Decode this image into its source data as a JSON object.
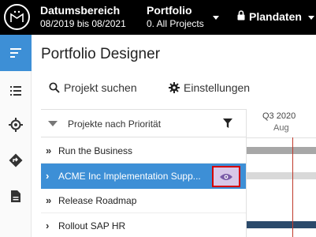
{
  "topbar": {
    "date_label": "Datumsbereich",
    "date_value": "08/2019 bis 08/2021",
    "portfolio_label": "Portfolio",
    "portfolio_value": "0. All Projects",
    "plan_label": "Plandaten"
  },
  "title": "Portfolio Designer",
  "toolbar": {
    "search_label": "Projekt suchen",
    "settings_label": "Einstellungen"
  },
  "tree": {
    "header_label": "Projekte nach Priorität",
    "rows": [
      {
        "label": "Run the Business",
        "chevron": "»"
      },
      {
        "label": "ACME Inc Implementation Supp...",
        "chevron": "›"
      },
      {
        "label": "Release Roadmap",
        "chevron": "»"
      },
      {
        "label": "Rollout SAP HR",
        "chevron": "›"
      }
    ]
  },
  "timeline": {
    "quarter": "Q3 2020",
    "month": "Aug"
  },
  "colors": {
    "accent": "#3d8fd6",
    "topbar": "#000000",
    "today_line": "#c0392b",
    "highlight_border": "#d40000",
    "eye_bg": "#d8c7e8"
  },
  "icons": [
    "logo-icon",
    "lock-icon",
    "menu-lines-icon",
    "list-icon",
    "target-icon",
    "direction-icon",
    "document-icon",
    "search-icon",
    "gear-icon",
    "filter-icon",
    "eye-icon"
  ]
}
